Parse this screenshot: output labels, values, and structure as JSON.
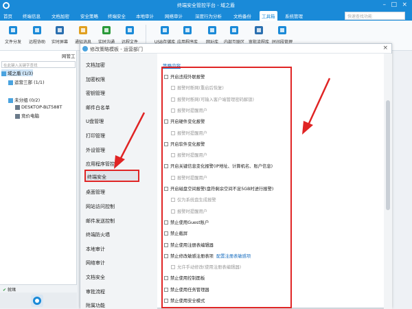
{
  "window": {
    "title": "终端安全管控平台 - 域之盾"
  },
  "menu": {
    "items": [
      "首页",
      "终端信息",
      "文档加密",
      "安全策略",
      "终端安全",
      "本地审计",
      "网络审计",
      "深度行为分析",
      "文档备份",
      "工具箱",
      "系统管理"
    ],
    "active_index": 9,
    "search_placeholder": "快速查找功能"
  },
  "ribbon": {
    "buttons": [
      {
        "label": "文件分发",
        "icon": "share-icon"
      },
      {
        "label": "远程协助",
        "icon": "remote-icon"
      },
      {
        "label": "实时屏幕",
        "icon": "screen-icon"
      },
      {
        "label": "通知消息",
        "icon": "bell-icon"
      },
      {
        "label": "实时沟通",
        "icon": "chat-icon"
      },
      {
        "label": "远程文件",
        "icon": "folder-icon"
      },
      {
        "label": "USB存储库",
        "icon": "usb-icon"
      },
      {
        "label": "应用程序库",
        "icon": "app-icon"
      },
      {
        "label": "网址库",
        "icon": "globe-icon"
      },
      {
        "label": "内部互联区",
        "icon": "network-icon"
      },
      {
        "label": "审批流程库",
        "icon": "approval-icon"
      },
      {
        "label": "时间段管理",
        "icon": "gear-icon"
      }
    ]
  },
  "left_panel": {
    "group_field_label": "网管工",
    "filter_placeholder": "在此键入关键字查找",
    "tree": [
      {
        "label": "域之盾 (1/3)",
        "level": 0
      },
      {
        "label": "运营三部 (1/1)",
        "level": 1
      },
      {
        "label": "未分组 (0/2)",
        "level": 1
      },
      {
        "label": "DESKTOP-BLT588T",
        "level": 2
      },
      {
        "label": "竞价电脑",
        "level": 2
      }
    ],
    "status": "就绪"
  },
  "dialog": {
    "title": "修改策略模板 - 运营部门",
    "nav_items": [
      "文档加密",
      "加密权限",
      "密钥管理",
      "邮件白名单",
      "U盘管理",
      "打印管理",
      "外设管理",
      "应用程序管控",
      "终端安全",
      "桌面管理",
      "网站访问控制",
      "邮件发送控制",
      "终端防火墙",
      "本地审计",
      "网络审计",
      "文档安全",
      "审批流程",
      "附属功能"
    ],
    "nav_selected_index": 8,
    "section_title": "策略内容",
    "options": [
      {
        "label": "开启违规外联报警",
        "indent": 0,
        "enabled": true
      },
      {
        "label": "报警时断网(重启后恢复)",
        "indent": 1,
        "enabled": false
      },
      {
        "label": "报警时断网(可输入客户端管理密码解锁)",
        "indent": 1,
        "enabled": false
      },
      {
        "label": "报警时提醒用户",
        "indent": 1,
        "enabled": false
      },
      {
        "label": "开启硬件变化报警",
        "indent": 0,
        "enabled": true
      },
      {
        "label": "报警时提醒用户",
        "indent": 1,
        "enabled": false
      },
      {
        "label": "开启软件变化报警",
        "indent": 0,
        "enabled": true
      },
      {
        "label": "报警时提醒用户",
        "indent": 1,
        "enabled": false
      },
      {
        "label": "开启关键信息变化报警(IP地址、计算机名、账户信息)",
        "indent": 0,
        "enabled": true
      },
      {
        "label": "报警时提醒用户",
        "indent": 1,
        "enabled": false
      },
      {
        "label": "开启磁盘空间报警(盘符剩余空间不足5GB时进行报警)",
        "indent": 0,
        "enabled": true
      },
      {
        "label": "仅为系统盘生成报警",
        "indent": 1,
        "enabled": false
      },
      {
        "label": "报警时提醒用户",
        "indent": 1,
        "enabled": false
      },
      {
        "label": "禁止使用Guest账户",
        "indent": 0,
        "enabled": true
      },
      {
        "label": "禁止截屏",
        "indent": 0,
        "enabled": true
      },
      {
        "label": "禁止使用注册表编辑器",
        "indent": 0,
        "enabled": true
      },
      {
        "label": "禁止修改敏感注册表项",
        "indent": 0,
        "enabled": true,
        "link": "配置注册表敏感项"
      },
      {
        "label": "允许手动修改(使用注册表编辑器)",
        "indent": 1,
        "enabled": false
      },
      {
        "label": "禁止使用控制面板",
        "indent": 0,
        "enabled": true
      },
      {
        "label": "禁止使用任务管理器",
        "indent": 0,
        "enabled": true
      },
      {
        "label": "禁止使用安全模式",
        "indent": 0,
        "enabled": true
      }
    ]
  },
  "colors": {
    "brand": "#1a8ad8",
    "highlight": "#e02424"
  }
}
